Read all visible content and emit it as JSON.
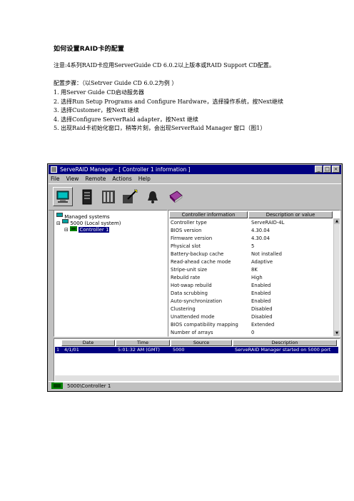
{
  "document": {
    "title": "如何设置RAID卡的配置",
    "note": "注意:4系列RAID卡应用ServerGuide CD 6.0.2以上版本或RAID Support CD配置。",
    "steps_intro": "配置步骤：（以Setrver Guide CD 6.0.2为例 ）",
    "steps": [
      "1. 用Server Guide CD启动服务器",
      "2. 选择Run Setup Programs and Configure Hardware，选择操作系统，按Next继续",
      "3. 选择Customer，按Next 继续",
      "4. 选择Configure ServerRaid adapter，按Next 继续",
      "5. 出现Raid卡初始化窗口，稍等片刻，会出现ServerRaid Manager 窗口（图1）"
    ]
  },
  "window": {
    "title": "ServeRAID Manager - [ Controller 1 information ]",
    "buttons": [
      "_",
      "□",
      "×"
    ],
    "menu": [
      "File",
      "View",
      "Remote",
      "Actions",
      "Help"
    ],
    "toolbar_icons": [
      "computer-icon",
      "server-icon",
      "drives-icon",
      "wizard-icon",
      "bell-icon",
      "book-icon"
    ]
  },
  "tree": {
    "root": "Managed systems",
    "system": "5000 (Local system)",
    "controller": "Controller 1"
  },
  "info": {
    "headers": [
      "Controller information",
      "Description or value"
    ],
    "rows": [
      {
        "label": "Controller type",
        "value": "ServeRAID-4L"
      },
      {
        "label": "BIOS version",
        "value": "4.30.04"
      },
      {
        "label": "Firmware version",
        "value": "4.30.04"
      },
      {
        "label": "Physical slot",
        "value": "5"
      },
      {
        "label": "Battery-backup cache",
        "value": "Not installed"
      },
      {
        "label": "Read-ahead cache mode",
        "value": "Adaptive"
      },
      {
        "label": "Stripe-unit size",
        "value": "8K"
      },
      {
        "label": "Rebuild rate",
        "value": "High"
      },
      {
        "label": "Hot-swap rebuild",
        "value": "Enabled"
      },
      {
        "label": "Data scrubbing",
        "value": "Enabled"
      },
      {
        "label": "Auto-synchronization",
        "value": "Enabled"
      },
      {
        "label": "Clustering",
        "value": "Disabled"
      },
      {
        "label": "Unattended mode",
        "value": "Disabled"
      },
      {
        "label": "BIOS compatibility mapping",
        "value": "Extended"
      },
      {
        "label": "Number of arrays",
        "value": "0"
      }
    ]
  },
  "log": {
    "headers": [
      "Date",
      "Time",
      "Source",
      "Description"
    ],
    "row": {
      "num": "1",
      "date": "4/1/01",
      "time": "5:01:32 AM (GMT)",
      "source": "5000",
      "desc": "ServeRAID Manager started on 5000 port"
    }
  },
  "status": {
    "text": "5000\\Controller 1"
  },
  "colors": {
    "titlebar": "#000080",
    "face": "#c0c0c0",
    "selection": "#000080"
  }
}
